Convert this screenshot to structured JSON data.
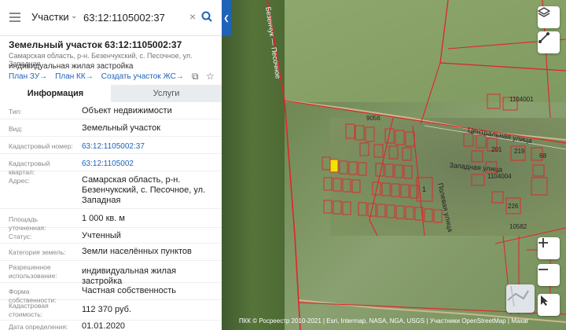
{
  "search": {
    "type_label": "Участки",
    "query": "63:12:1105002:37"
  },
  "parcel": {
    "title": "Земельный участок 63:12:1105002:37",
    "address_short": "Самарская область, р-н. Безенчукский, с. Песочное, ул. Западная",
    "usage_short": "индивидуальная жилая застройка",
    "links": [
      "План ЗУ→",
      "План КК→",
      "Создать участок ЖС→"
    ]
  },
  "tabs": [
    "Информация",
    "Услуги"
  ],
  "info_rows": [
    {
      "key": "Тип:",
      "value": "Объект недвижимости"
    },
    {
      "key": "Вид:",
      "value": "Земельный участок"
    },
    {
      "key": "Кадастровый номер:",
      "value": "63:12:1105002:37",
      "link": true
    },
    {
      "key": "Кадастровый квартал:",
      "value": "63:12:1105002",
      "link": true
    },
    {
      "key": "Адрес:",
      "value": "Самарская область, р-н. Безенчукский, с. Песочное, ул. Западная"
    },
    {
      "key": "Площадь уточненная:",
      "value": "1 000 кв. м"
    },
    {
      "key": "Статус:",
      "value": "Учтенный"
    },
    {
      "key": "Категория земель:",
      "value": "Земли населённых пунктов"
    },
    {
      "key": "Разрешенное использование:",
      "value": "индивидуальная жилая застройка"
    },
    {
      "key": "Форма собственности:",
      "value": "Частная собственность"
    },
    {
      "key": "Кадастровая стоимость:",
      "value": "112 370 руб."
    },
    {
      "key": "Дата определения:",
      "value": "01.01.2020"
    }
  ],
  "map": {
    "road_labels": [
      "Безенчук — Песочное",
      "Центральная улица",
      "Западная улица",
      "Полевая улица"
    ],
    "parcel_numbers": [
      "9056",
      "1104001",
      "1104004",
      "201",
      "219",
      "68",
      "226",
      "10582",
      "1"
    ],
    "attribution": "ПКК © Росреестр 2010-2021 | Esri, Intermap, NASA, NGA, USGS | Участники OpenStreetMap | Maxar"
  },
  "colors": {
    "accent": "#1e63b8",
    "boundary": "#e0242b",
    "selected_parcel": "#f2e400"
  }
}
